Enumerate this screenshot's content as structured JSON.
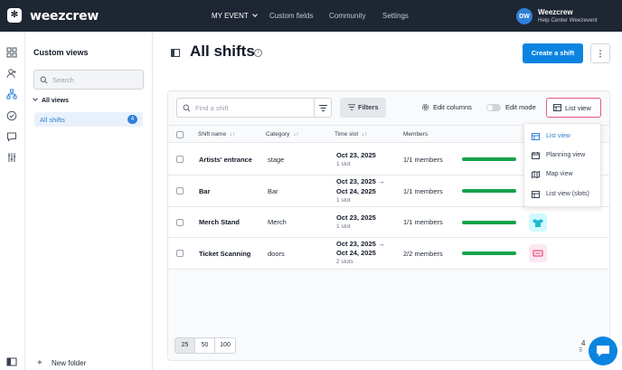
{
  "app": {
    "logo_text": "weezcrew",
    "logo_glyph": "✻"
  },
  "topnav": {
    "items": [
      {
        "label": "MY EVENT"
      },
      {
        "label": "Custom fields"
      },
      {
        "label": "Community"
      },
      {
        "label": "Settings"
      }
    ]
  },
  "user": {
    "initials": "DW",
    "name": "Weezcrew",
    "subtitle": "Help Center Weezevent"
  },
  "sidebar": {
    "title": "Custom views",
    "search_placeholder": "Search",
    "group_label": "All views",
    "items": [
      {
        "label": "All shifts",
        "count": "4"
      }
    ],
    "new_folder_label": "New folder"
  },
  "header": {
    "title": "All shifts",
    "info_glyph": "i",
    "create_label": "Create a shift",
    "more_glyph": "⋮"
  },
  "toolbar": {
    "find_placeholder": "Find a shift",
    "filters_label": "Filters",
    "edit_columns_label": "Edit columns",
    "edit_mode_label": "Edit mode",
    "view_label": "List view"
  },
  "table": {
    "columns": {
      "shift_name": "Shift name",
      "category": "Category",
      "time_slot": "Time slot",
      "members": "Members",
      "sort_glyph": "↓↑"
    },
    "rows": [
      {
        "name": "Artists' entrance",
        "category": "stage",
        "slot_line1": "Oct 23, 2025",
        "slot_line2": "",
        "slots": "1 slot",
        "members": "1/1 members",
        "icon": "stage-icon",
        "icon_color": "#dbeafe"
      },
      {
        "name": "Bar",
        "category": "Bar",
        "slot_line1": "Oct 23, 2025 →",
        "slot_line2": "Oct 24, 2025",
        "slots": "1 slot",
        "members": "1/1 members",
        "icon": "bar-icon",
        "icon_color": "#dbeafe"
      },
      {
        "name": "Merch Stand",
        "category": "Merch",
        "slot_line1": "Oct 23, 2025",
        "slot_line2": "",
        "slots": "1 slot",
        "members": "1/1 members",
        "icon": "tshirt-icon",
        "icon_color": "#cffafe"
      },
      {
        "name": "Ticket Scanning",
        "category": "doors",
        "slot_line1": "Oct 23, 2025 →",
        "slot_line2": "Oct 24, 2025",
        "slots": "2 slots",
        "members": "2/2 members",
        "icon": "ticket-icon",
        "icon_color": "#fce7f3"
      }
    ]
  },
  "view_menu": {
    "items": [
      {
        "label": "List view",
        "icon": "list-icon",
        "active": true
      },
      {
        "label": "Planning view",
        "icon": "calendar-icon",
        "active": false
      },
      {
        "label": "Map view",
        "icon": "map-icon",
        "active": false
      },
      {
        "label": "List view (slots)",
        "icon": "list-icon",
        "active": false
      }
    ]
  },
  "pagination": {
    "sizes": [
      "25",
      "50",
      "100"
    ],
    "selected": "25"
  },
  "chat": {
    "count": "4"
  },
  "colors": {
    "brand_dark": "#1e2533",
    "primary": "#0b84e0",
    "accent_pink": "#e8557a",
    "success": "#16a34a"
  }
}
